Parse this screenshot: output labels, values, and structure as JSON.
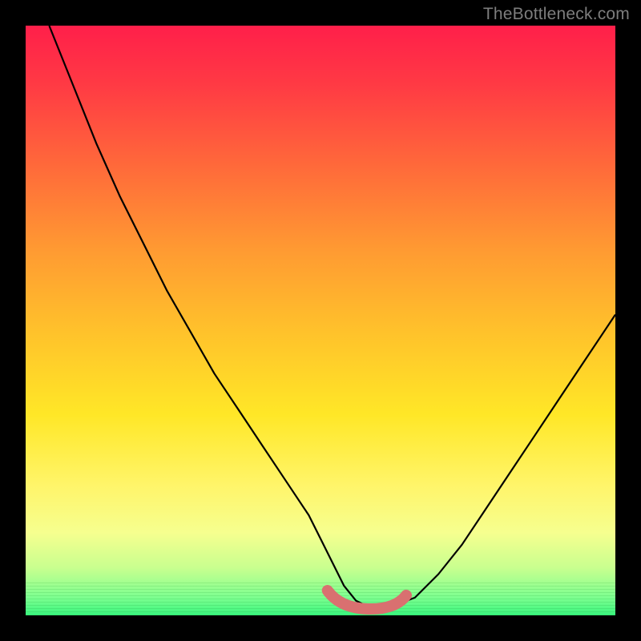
{
  "watermark": "TheBottleneck.com",
  "colors": {
    "curve_stroke": "#000000",
    "highlight_stroke": "#d97070"
  },
  "chart_data": {
    "type": "line",
    "title": "",
    "xlabel": "",
    "ylabel": "",
    "xlim": [
      0,
      100
    ],
    "ylim": [
      0,
      100
    ],
    "grid": false,
    "series": [
      {
        "name": "bottleneck-curve",
        "x": [
          4,
          8,
          12,
          16,
          20,
          24,
          28,
          32,
          36,
          40,
          44,
          48,
          50,
          52,
          54,
          56,
          58,
          60,
          62,
          66,
          70,
          74,
          78,
          82,
          86,
          90,
          94,
          98,
          100
        ],
        "y": [
          100,
          90,
          80,
          71,
          63,
          55,
          48,
          41,
          35,
          29,
          23,
          17,
          13,
          9,
          5,
          2.5,
          1.5,
          1.2,
          1.5,
          3,
          7,
          12,
          18,
          24,
          30,
          36,
          42,
          48,
          51
        ]
      }
    ],
    "annotations": [
      {
        "name": "optimal-region",
        "x_range": [
          52,
          64
        ],
        "y": 1.5,
        "note": "thick salmon marker along valley floor"
      }
    ]
  }
}
